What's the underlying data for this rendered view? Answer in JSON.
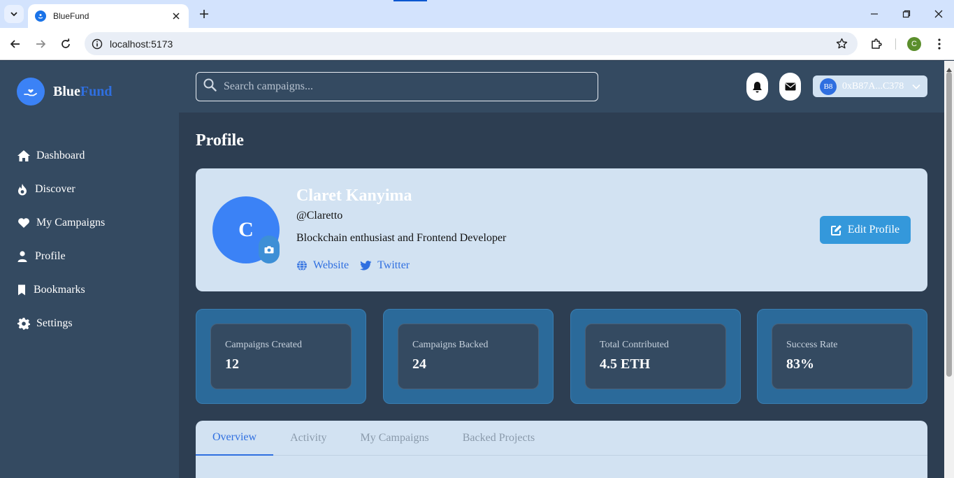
{
  "browser": {
    "tab_title": "BlueFund",
    "url": "localhost:5173",
    "profile_initial": "C"
  },
  "app": {
    "logo": {
      "part1": "Blue",
      "part2": "Fund"
    },
    "nav": [
      {
        "label": "Dashboard",
        "icon": "home-icon"
      },
      {
        "label": "Discover",
        "icon": "fire-icon"
      },
      {
        "label": "My Campaigns",
        "icon": "heart-icon"
      },
      {
        "label": "Profile",
        "icon": "user-icon"
      },
      {
        "label": "Bookmarks",
        "icon": "bookmark-icon"
      },
      {
        "label": "Settings",
        "icon": "gear-icon"
      }
    ],
    "search": {
      "placeholder": "Search campaigns..."
    },
    "wallet": {
      "badge": "B8",
      "address": "0xB87A...C378"
    },
    "colors": {
      "accent": "#2f6fe0",
      "sidebar": "#344a61",
      "main_bg": "#2d3e52",
      "card": "#d2e2f2",
      "stat_bg": "#2b6a9a"
    }
  },
  "profile": {
    "page_title": "Profile",
    "avatar_initial": "C",
    "name": "Claret Kanyima",
    "handle": "@Claretto",
    "bio": "Blockchain enthusiast and Frontend Developer",
    "links": {
      "website": "Website",
      "twitter": "Twitter"
    },
    "edit_label": "Edit Profile"
  },
  "stats": [
    {
      "label": "Campaigns Created",
      "value": "12"
    },
    {
      "label": "Campaigns Backed",
      "value": "24"
    },
    {
      "label": "Total Contributed",
      "value": "4.5 ETH"
    },
    {
      "label": "Success Rate",
      "value": "83%"
    }
  ],
  "tabs": [
    {
      "label": "Overview",
      "active": true
    },
    {
      "label": "Activity",
      "active": false
    },
    {
      "label": "My Campaigns",
      "active": false
    },
    {
      "label": "Backed Projects",
      "active": false
    }
  ]
}
